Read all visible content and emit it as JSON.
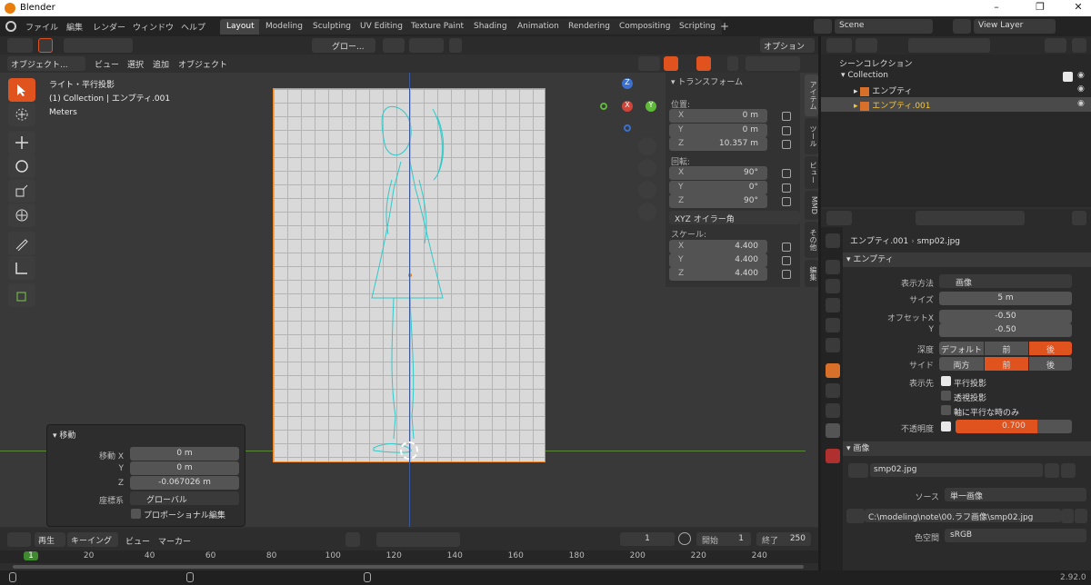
{
  "window": {
    "title": "Blender",
    "minimize": "–",
    "maximize": "❐",
    "close": "✕"
  },
  "menu": [
    "ファイル",
    "編集",
    "レンダー",
    "ウィンドウ",
    "ヘルプ"
  ],
  "workspaces": [
    "Layout",
    "Modeling",
    "Sculpting",
    "UV Editing",
    "Texture Paint",
    "Shading",
    "Animation",
    "Rendering",
    "Compositing",
    "Scripting"
  ],
  "workspace_add": "+",
  "scene": "Scene",
  "view_layer": "View Layer",
  "viewport": {
    "transform_orientation": "グロー...",
    "options": "オプション",
    "mode": "オブジェクト...",
    "menus": [
      "ビュー",
      "選択",
      "追加",
      "オブジェクト"
    ],
    "info": [
      "ライト・平行投影",
      "(1) Collection | エンプティ.001",
      "Meters"
    ]
  },
  "npanel": {
    "header": "トランスフォーム",
    "location_label": "位置:",
    "location": [
      {
        "axis": "X",
        "value": "0 m"
      },
      {
        "axis": "Y",
        "value": "0 m"
      },
      {
        "axis": "Z",
        "value": "10.357 m"
      }
    ],
    "rotation_label": "回転:",
    "rotation": [
      {
        "axis": "X",
        "value": "90°"
      },
      {
        "axis": "Y",
        "value": "0°"
      },
      {
        "axis": "Z",
        "value": "90°"
      }
    ],
    "rotation_mode": "XYZ オイラー角",
    "scale_label": "スケール:",
    "scale": [
      {
        "axis": "X",
        "value": "4.400"
      },
      {
        "axis": "Y",
        "value": "4.400"
      },
      {
        "axis": "Z",
        "value": "4.400"
      }
    ],
    "tabs": [
      "アイテム",
      "ツール",
      "ビュー",
      "MMD",
      "その他",
      "編集"
    ]
  },
  "operator": {
    "title": "移動",
    "rows": [
      {
        "label": "移動 X",
        "value": "0 m"
      },
      {
        "label": "Y",
        "value": "0 m"
      },
      {
        "label": "Z",
        "value": "-0.067026 m"
      }
    ],
    "orient_label": "座標系",
    "orient_value": "グローバル",
    "proportional": "プロポーショナル編集"
  },
  "outliner": {
    "root": "シーンコレクション",
    "collection": "Collection",
    "items": [
      {
        "name": "エンプティ",
        "selected": false
      },
      {
        "name": "エンプティ.001",
        "selected": true
      }
    ]
  },
  "properties": {
    "breadcrumb_obj": "エンプティ.001",
    "breadcrumb_img": "smp02.jpg",
    "empty_section": "エンプティ",
    "display_label": "表示方法",
    "display_value": "画像",
    "size_label": "サイズ",
    "size_value": "5 m",
    "offset_x_label": "オフセットX",
    "offset_x": "-0.50",
    "offset_y_label": "Y",
    "offset_y": "-0.50",
    "depth_label": "深度",
    "depth_options": [
      "デフォルト",
      "前",
      "後"
    ],
    "depth_active": 2,
    "side_label": "サイド",
    "side_options": [
      "両方",
      "前",
      "後"
    ],
    "side_active": 1,
    "show_label": "表示先",
    "show_options": [
      {
        "label": "平行投影",
        "checked": true
      },
      {
        "label": "透視投影",
        "checked": false
      },
      {
        "label": "軸に平行な時のみ",
        "checked": false
      }
    ],
    "opacity_label": "不透明度",
    "opacity_value": "0.700",
    "opacity": 0.7,
    "image_section": "画像",
    "image_name": "smp02.jpg",
    "source_label": "ソース",
    "source_value": "単一画像",
    "filepath": "C:\\modeling\\note\\00.ラフ画像\\smp02.jpg",
    "colorspace_label": "色空間",
    "colorspace_value": "sRGB"
  },
  "timeline": {
    "playback": "再生",
    "keying": "キーイング",
    "view": "ビュー",
    "marker": "マーカー",
    "current_frame": "1",
    "start_label": "開始",
    "start": "1",
    "end_label": "終了",
    "end": "250",
    "ticks": [
      "1",
      "20",
      "40",
      "60",
      "80",
      "100",
      "120",
      "140",
      "160",
      "180",
      "200",
      "220",
      "240"
    ]
  },
  "version": "2.92.0",
  "colors": {
    "accent": "#e0531f",
    "selected_text": "#f5c542",
    "bg": "#303030"
  }
}
